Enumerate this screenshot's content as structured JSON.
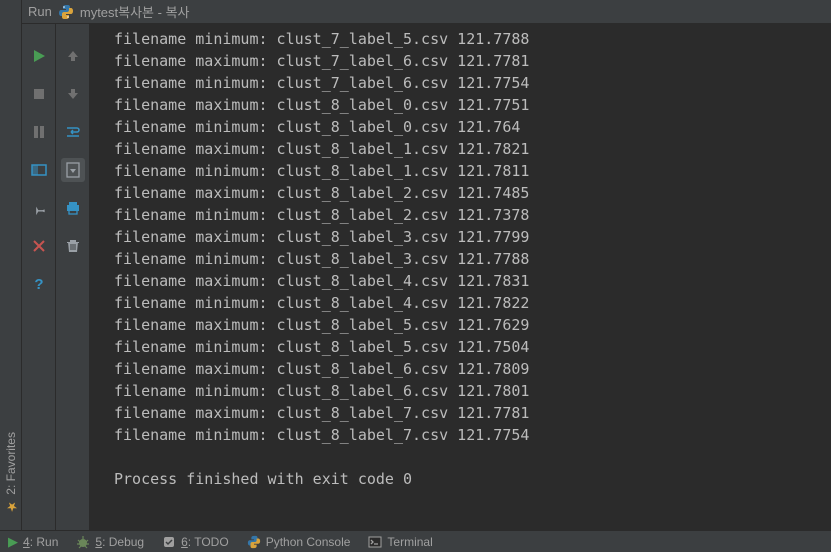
{
  "header": {
    "run_label": "Run",
    "config_name": "mytest복사본 - 복사",
    "py_icon": "python-icon"
  },
  "sidebar_vertical": {
    "favorites": {
      "label": "2: Favorites",
      "icon": "star-icon"
    }
  },
  "gutter1": {
    "run": "play-icon",
    "stop": "stop-icon",
    "pause": "pause-icon",
    "layout": "layout-icon",
    "pin": "pin-icon",
    "close": "close-icon",
    "help": "help-icon"
  },
  "gutter2": {
    "up": "arrow-up-icon",
    "down": "arrow-down-icon",
    "wrap": "soft-wrap-icon",
    "scroll": "scroll-to-end-icon",
    "print": "print-icon",
    "trash": "trash-icon"
  },
  "console": {
    "lines": [
      "filename minimum: clust_7_label_5.csv 121.7788",
      "filename maximum: clust_7_label_6.csv 121.7781",
      "filename minimum: clust_7_label_6.csv 121.7754",
      "filename maximum: clust_8_label_0.csv 121.7751",
      "filename minimum: clust_8_label_0.csv 121.764",
      "filename maximum: clust_8_label_1.csv 121.7821",
      "filename minimum: clust_8_label_1.csv 121.7811",
      "filename maximum: clust_8_label_2.csv 121.7485",
      "filename minimum: clust_8_label_2.csv 121.7378",
      "filename maximum: clust_8_label_3.csv 121.7799",
      "filename minimum: clust_8_label_3.csv 121.7788",
      "filename maximum: clust_8_label_4.csv 121.7831",
      "filename minimum: clust_8_label_4.csv 121.7822",
      "filename maximum: clust_8_label_5.csv 121.7629",
      "filename minimum: clust_8_label_5.csv 121.7504",
      "filename maximum: clust_8_label_6.csv 121.7809",
      "filename minimum: clust_8_label_6.csv 121.7801",
      "filename maximum: clust_8_label_7.csv 121.7781",
      "filename minimum: clust_8_label_7.csv 121.7754",
      "",
      "Process finished with exit code 0"
    ]
  },
  "status": {
    "run": {
      "key": "4",
      "label": ": Run"
    },
    "debug": {
      "key": "5",
      "label": ": Debug"
    },
    "todo": {
      "key": "6",
      "label": ": TODO"
    },
    "pyconsole": {
      "label": "Python Console"
    },
    "terminal": {
      "label": "Terminal"
    }
  }
}
